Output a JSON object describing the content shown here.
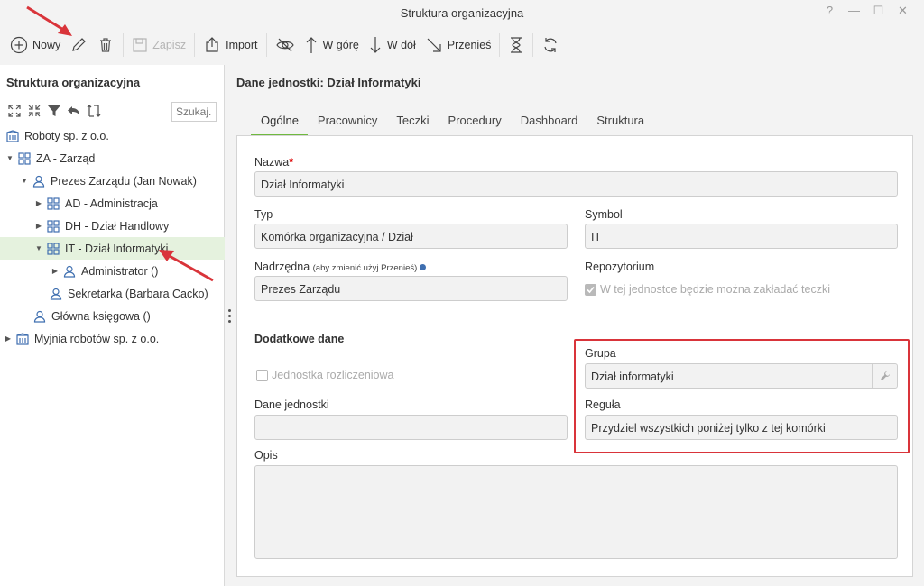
{
  "window": {
    "title": "Struktura organizacyjna",
    "controls": [
      "?",
      "—",
      "☐",
      "✕"
    ]
  },
  "toolbar": {
    "new_label": "Nowy",
    "save_label": "Zapisz",
    "import_label": "Import",
    "up_label": "W górę",
    "down_label": "W dół",
    "move_label": "Przenieś"
  },
  "left": {
    "heading": "Struktura organizacyjna",
    "search_placeholder": "Szukaj...",
    "tree": [
      {
        "label": "Roboty sp. z o.o.",
        "icon": "company-icon",
        "arrow": ""
      },
      {
        "label": "ZA - Zarząd",
        "icon": "unit-icon",
        "arrow": "▼"
      },
      {
        "label": "Prezes Zarządu (Jan Nowak)",
        "icon": "person-icon",
        "arrow": "▼"
      },
      {
        "label": "AD - Administracja",
        "icon": "unit-icon",
        "arrow": "▶"
      },
      {
        "label": "DH - Dział Handlowy",
        "icon": "unit-icon",
        "arrow": "▶"
      },
      {
        "label": "IT - Dział Informatyki",
        "icon": "unit-icon",
        "arrow": "▼"
      },
      {
        "label": "Administrator ()",
        "icon": "person-icon",
        "arrow": "▶"
      },
      {
        "label": "Sekretarka (Barbara Cacko)",
        "icon": "person-icon",
        "arrow": ""
      },
      {
        "label": "Główna księgowa ()",
        "icon": "person-icon",
        "arrow": ""
      },
      {
        "label": "Myjnia robotów sp. z o.o.",
        "icon": "company-icon",
        "arrow": "▶"
      }
    ]
  },
  "right": {
    "heading": "Dane jednostki: Dział Informatyki",
    "tabs": [
      "Ogólne",
      "Pracownicy",
      "Teczki",
      "Procedury",
      "Dashboard",
      "Struktura"
    ],
    "form": {
      "nazwa_label": "Nazwa",
      "nazwa_value": "Dział Informatyki",
      "typ_label": "Typ",
      "typ_value": "Komórka organizacyjna / Dział",
      "symbol_label": "Symbol",
      "symbol_value": "IT",
      "nadrzedna_label": "Nadrzędna",
      "nadrzedna_hint": "(aby zmienić użyj Przenieś)",
      "nadrzedna_value": "Prezes Zarządu",
      "repo_label": "Repozytorium",
      "repo_checkbox": "W tej jednostce będzie można zakładać teczki",
      "dodatkowe_label": "Dodatkowe dane",
      "rozliczeniowa_checkbox": "Jednostka rozliczeniowa",
      "dane_label": "Dane jednostki",
      "dane_value": "",
      "grupa_label": "Grupa",
      "grupa_value": "Dział informatyki",
      "regula_label": "Reguła",
      "regula_value": "Przydziel wszystkich poniżej tylko z tej komórki",
      "opis_label": "Opis",
      "opis_value": ""
    }
  },
  "colors": {
    "accent": "#6fb93f",
    "selected_row": "#e5f2de",
    "annotation": "#d9343a",
    "icon_blue": "#3f6fb0"
  }
}
